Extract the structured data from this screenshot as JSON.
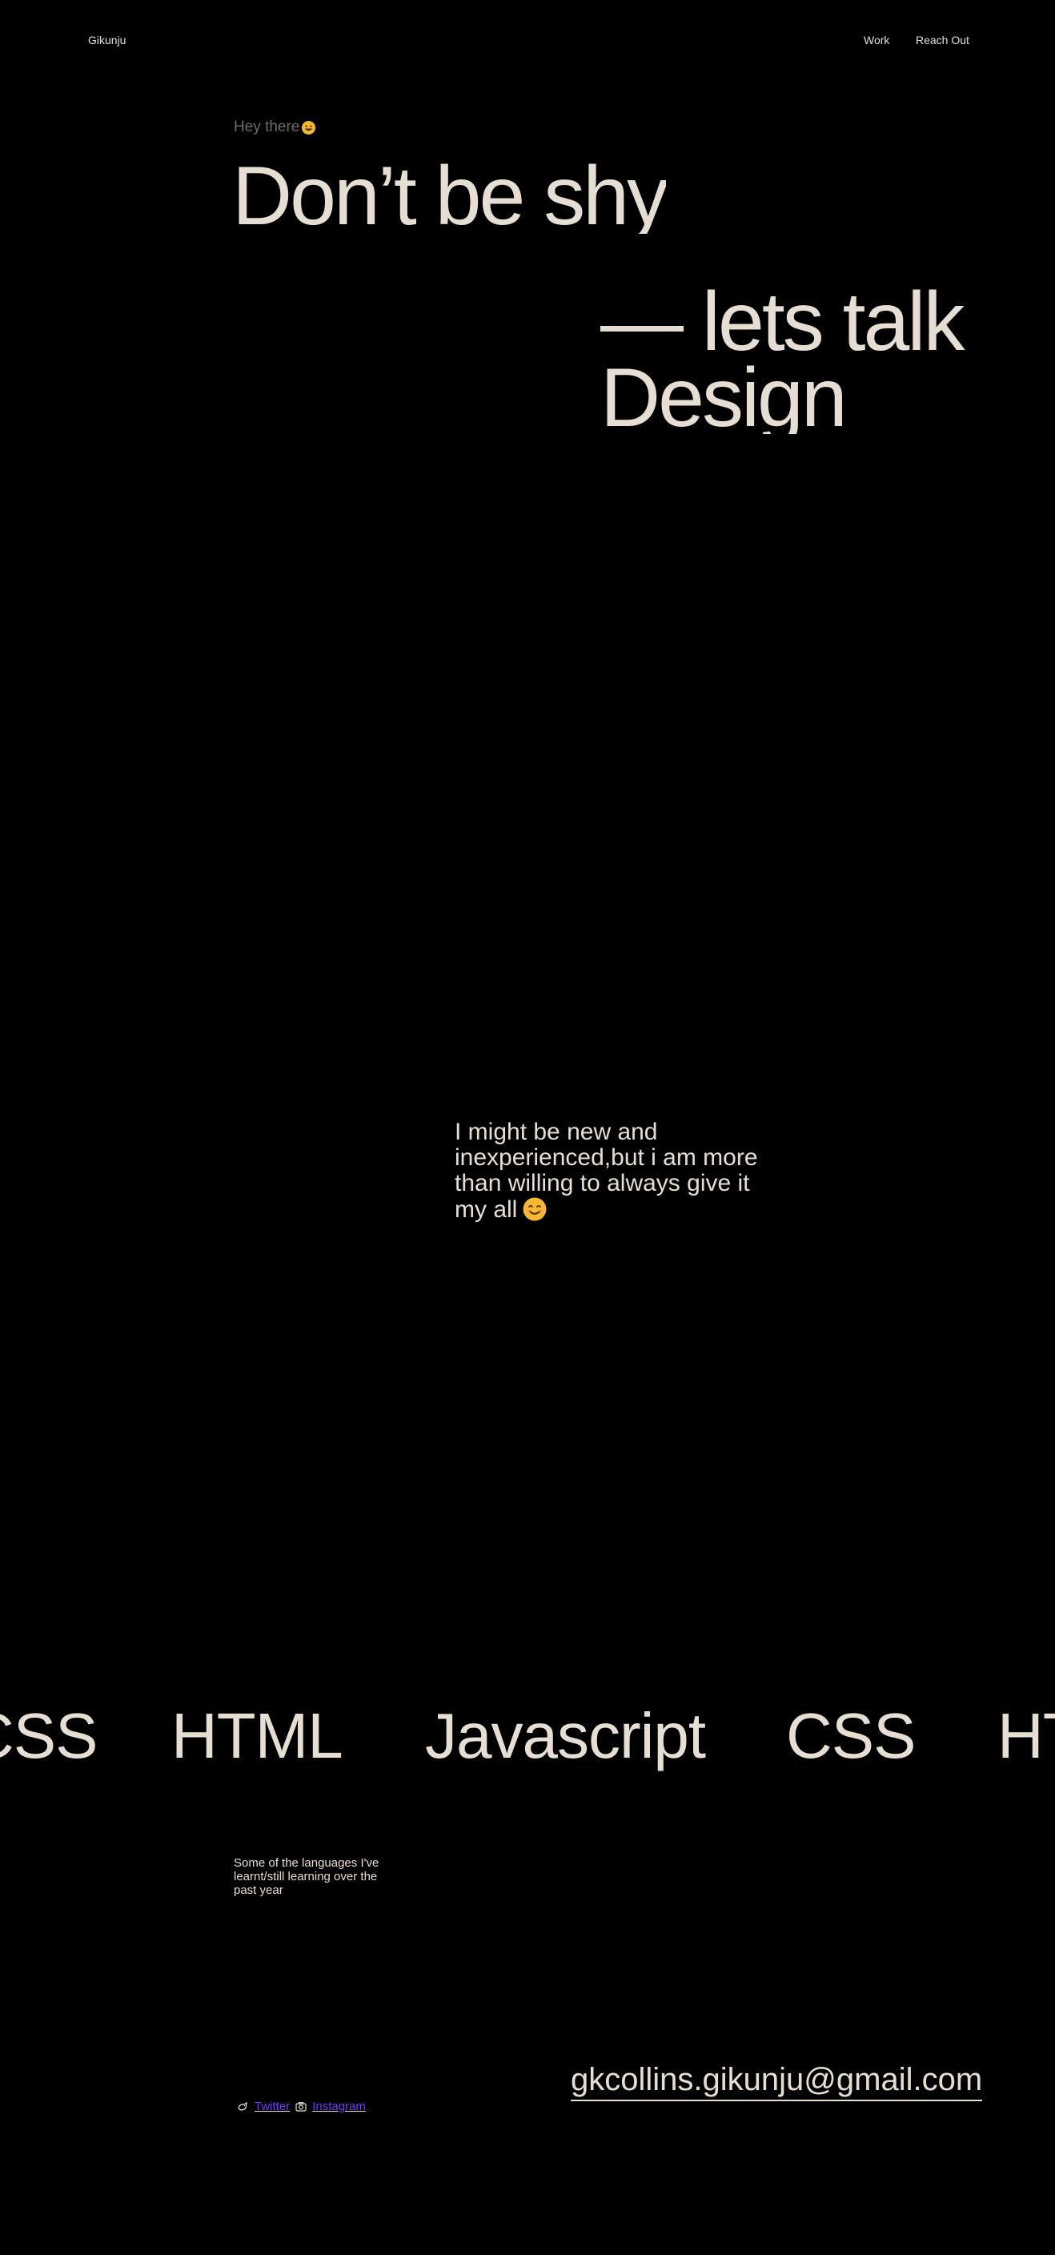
{
  "header": {
    "brand": "Gikunju",
    "nav": [
      {
        "label": "Work"
      },
      {
        "label": "Reach Out"
      }
    ]
  },
  "hero": {
    "greeting": "Hey there",
    "greeting_icon": "grinning-face-icon",
    "line1": "Don’t be shy",
    "line2": "— lets talk",
    "line3": "Design"
  },
  "statement": {
    "text": "I might be new and inexperienced,but i am more than willing to always give it my all",
    "icon": "smiling-face-icon"
  },
  "marquee": {
    "words": [
      "CSS",
      "HTML",
      "Javascript",
      "CSS",
      "HTML"
    ]
  },
  "languages_caption": "Some of the languages I've learnt/still learning over the past year",
  "footer": {
    "socials": [
      {
        "label": "Twitter",
        "icon": "bird-icon"
      },
      {
        "label": "Instagram",
        "icon": "camera-icon"
      }
    ],
    "email": "gkcollins.gikunju@gmail.com"
  },
  "colors": {
    "background": "#000000",
    "text": "#e6ded2",
    "muted": "#6f6a63",
    "link": "#6d3ef0",
    "emoji": "#f5b82e"
  }
}
